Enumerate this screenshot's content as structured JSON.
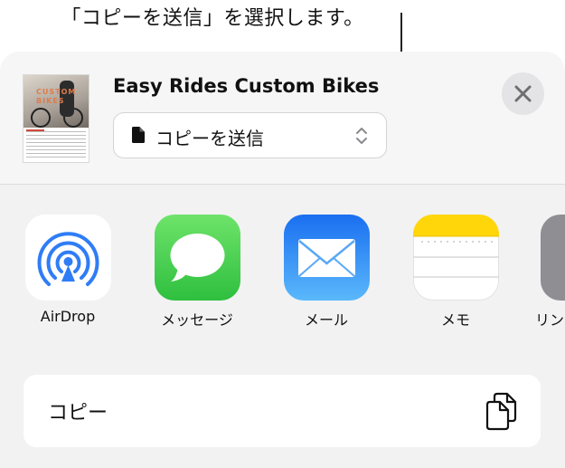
{
  "callout": {
    "text": "「コピーを送信」を選択します。"
  },
  "share_sheet": {
    "document_title": "Easy Rides Custom Bikes",
    "thumbnail": {
      "title_line1": "CUSTOM",
      "title_line2": "BIKES"
    },
    "send_option": {
      "label": "コピーを送信",
      "icon": "doc-icon",
      "chevron": "up-down-chevron-icon"
    },
    "close": {
      "icon": "close-icon"
    }
  },
  "apps": [
    {
      "label": "AirDrop",
      "icon": "airdrop-icon",
      "color": "#2f7df6"
    },
    {
      "label": "メッセージ",
      "icon": "messages-icon",
      "color": "#34c759"
    },
    {
      "label": "メール",
      "icon": "mail-icon",
      "color": "#1e7cf2"
    },
    {
      "label": "メモ",
      "icon": "notes-icon",
      "color": "#ffd60a"
    },
    {
      "label": "リン",
      "icon": "link-icon",
      "color": "#8e8e93"
    }
  ],
  "actions": [
    {
      "label": "コピー",
      "icon": "copy-icon"
    }
  ]
}
